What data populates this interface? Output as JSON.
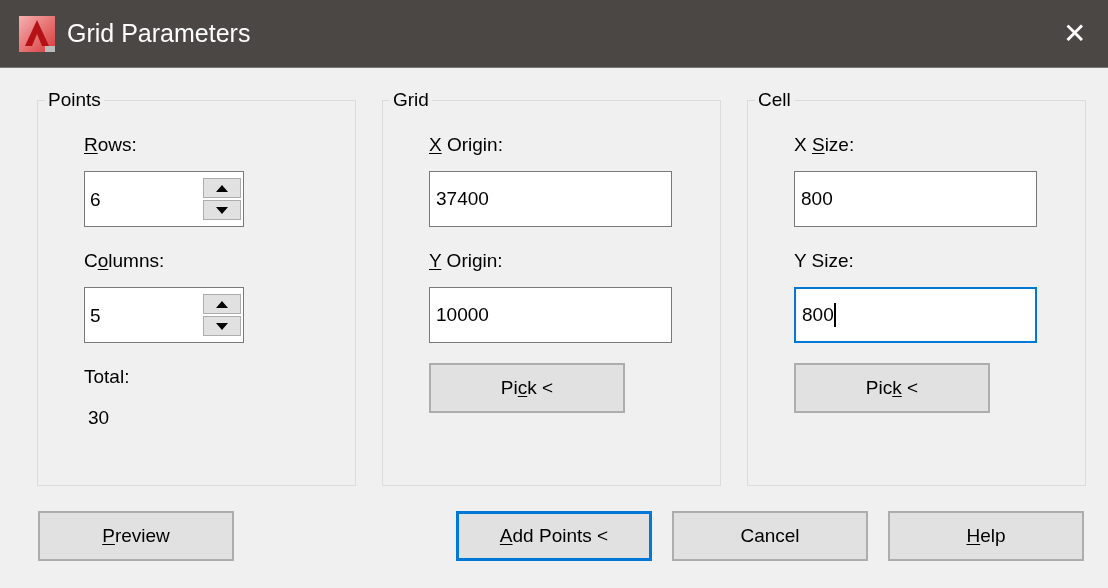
{
  "window": {
    "title": "Grid Parameters",
    "close": "✕"
  },
  "groups": [
    {
      "title": "Points",
      "items": [
        {
          "kind": "spin",
          "label": {
            "key": "R",
            "post": "ows:"
          },
          "value": "6",
          "focused": false
        },
        {
          "kind": "spin",
          "label": {
            "pre": "C",
            "key": "o",
            "post": "lumns:"
          },
          "value": "5",
          "focused": false
        },
        {
          "kind": "readout",
          "label": "Total:",
          "value": "30"
        }
      ]
    },
    {
      "title": "Grid",
      "items": [
        {
          "kind": "field",
          "label": {
            "key": "X",
            "post": " Origin:"
          },
          "value": "37400",
          "focused": false
        },
        {
          "kind": "field",
          "label": {
            "key": "Y",
            "post": " Origin:"
          },
          "value": "10000",
          "focused": false
        },
        {
          "kind": "button",
          "label": {
            "pre": "Pi",
            "key": "c",
            "post": "k <"
          }
        }
      ]
    },
    {
      "title": "Cell",
      "items": [
        {
          "kind": "field",
          "label": {
            "pre": "X ",
            "key": "S",
            "post": "ize:"
          },
          "value": "800",
          "focused": false
        },
        {
          "kind": "field",
          "label": {
            "pre": "Y Size:"
          },
          "value": "800",
          "focused": true
        },
        {
          "kind": "button",
          "label": {
            "pre": "Pic",
            "key": "k",
            "post": " <"
          }
        }
      ]
    }
  ],
  "buttons": [
    {
      "label": {
        "key": "P",
        "post": "review"
      },
      "default": false
    },
    {
      "label": {
        "key": "A",
        "post": "dd Points <"
      },
      "default": true
    },
    {
      "label": {
        "pre": "Cancel"
      },
      "default": false
    },
    {
      "label": {
        "key": "H",
        "post": "elp"
      },
      "default": false
    }
  ]
}
